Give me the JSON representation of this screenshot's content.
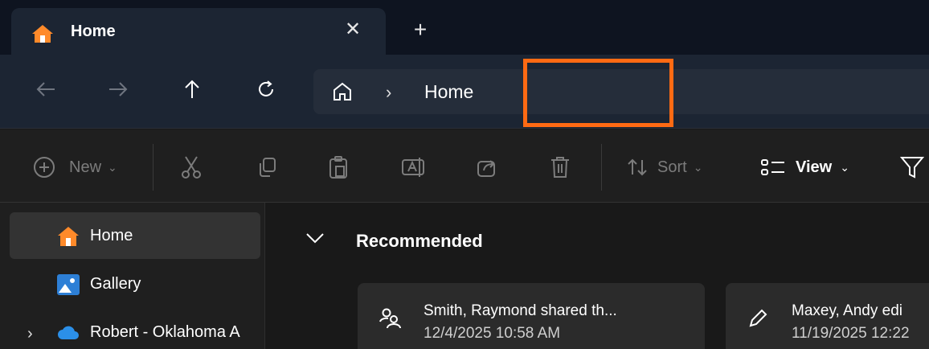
{
  "tab": {
    "title": "Home",
    "close_glyph": "✕",
    "new_glyph": "+"
  },
  "nav": {
    "back_icon": "arrow-left-icon",
    "forward_icon": "arrow-right-icon",
    "up_icon": "arrow-up-icon",
    "refresh_icon": "refresh-icon",
    "breadcrumb_separator": "›",
    "breadcrumb": [
      "Home"
    ]
  },
  "toolbar": {
    "new_label": "New",
    "sort_label": "Sort",
    "view_label": "View",
    "dropdown_glyph": "⌄"
  },
  "sidebar": {
    "items": [
      {
        "label": "Home",
        "icon": "home-icon",
        "selected": true
      },
      {
        "label": "Gallery",
        "icon": "gallery-icon",
        "selected": false
      },
      {
        "label": "Robert - Oklahoma A",
        "icon": "onedrive-cloud-icon",
        "selected": false,
        "expander": "›"
      }
    ]
  },
  "main": {
    "section_title": "Recommended",
    "cards": [
      {
        "title": "Smith, Raymond shared th...",
        "date": "12/4/2025 10:58 AM",
        "icon": "people-shared-icon"
      },
      {
        "title": "Maxey, Andy edi",
        "date": "11/19/2025 12:22",
        "icon": "pencil-edit-icon"
      }
    ]
  },
  "colors": {
    "highlight": "#ff6a13",
    "home_icon": "#ff8a2a",
    "onedrive": "#2b8fe8"
  }
}
